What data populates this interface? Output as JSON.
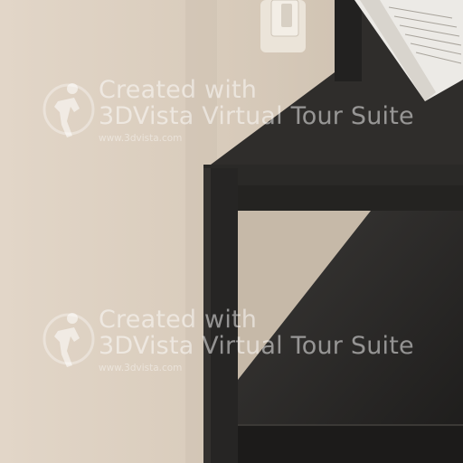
{
  "watermarks": [
    {
      "line1": "Created with",
      "line2": "3DVista Virtual Tour Suite",
      "url": "www.3dvista.com",
      "logo": "3dvista-person-logo"
    },
    {
      "line1": "Created with",
      "line2": "3DVista Virtual Tour Suite",
      "url": "www.3dvista.com",
      "logo": "3dvista-person-logo"
    }
  ],
  "colors": {
    "wall": "#dacdbf",
    "wall_shadow": "#cdbfae",
    "shelf": "#2b2a28",
    "shelf_dark": "#1f1e1d",
    "switch_plate": "#ede6dc",
    "book_pages": "#ece9e4"
  }
}
